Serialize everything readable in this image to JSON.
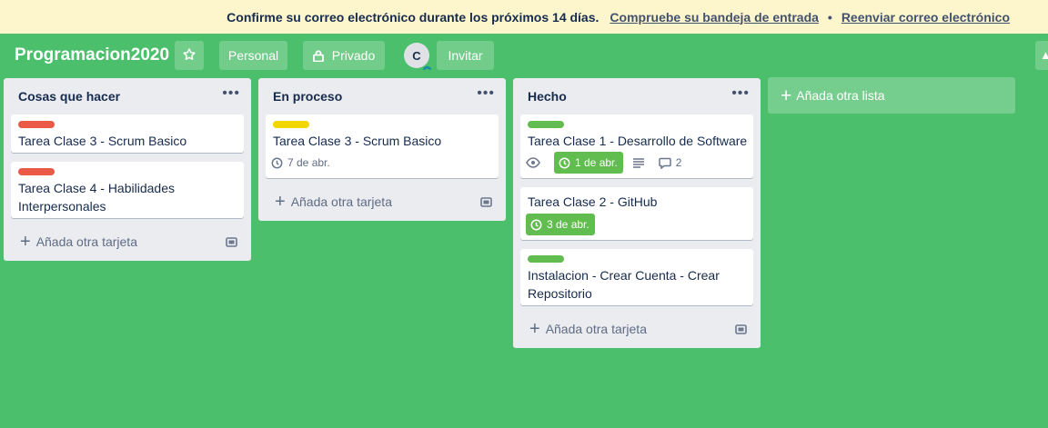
{
  "banner": {
    "message": "Confirme su correo electrónico durante los próximos 14 días.",
    "check_inbox_link": "Compruebe su bandeja de entrada",
    "separator": "•",
    "resend_link": "Reenviar correo electrónico"
  },
  "header": {
    "board_title": "Programacion2020",
    "star_icon": "star-icon",
    "team_label": "Personal",
    "visibility_label": "Privado",
    "member_initial": "C",
    "invite_label": "Invitar"
  },
  "lists": [
    {
      "title": "Cosas que hacer",
      "menu_icon": "•••",
      "cards": [
        {
          "label_color": "#eb5a46",
          "title": "Tarea Clase 3 - Scrum Basico"
        },
        {
          "label_color": "#eb5a46",
          "title": "Tarea Clase 4 - Habilidades Interpersonales"
        }
      ],
      "add_card_label": "Añada otra tarjeta"
    },
    {
      "title": "En proceso",
      "menu_icon": "•••",
      "cards": [
        {
          "label_color": "#f2d600",
          "title": "Tarea Clase 3 - Scrum Basico",
          "due": "7 de abr."
        }
      ],
      "add_card_label": "Añada otra tarjeta"
    },
    {
      "title": "Hecho",
      "menu_icon": "•••",
      "cards": [
        {
          "label_color": "#61bd4f",
          "title": "Tarea Clase 1 - Desarrollo de Software",
          "due": "1 de abr.",
          "due_complete": true,
          "watching": true,
          "has_description": true,
          "comments": "2"
        },
        {
          "title": "Tarea Clase 2 - GitHub",
          "due": "3 de abr.",
          "due_complete": true
        },
        {
          "label_color": "#61bd4f",
          "title": "Instalacion - Crear Cuenta - Crear Repositorio"
        }
      ],
      "add_card_label": "Añada otra tarjeta"
    }
  ],
  "add_list_label": "Añada otra lista",
  "colors": {
    "board_background": "#4bbf6b",
    "banner_background": "#fdf5cc",
    "list_background": "#ebecf0",
    "due_complete": "#61bd4f"
  }
}
